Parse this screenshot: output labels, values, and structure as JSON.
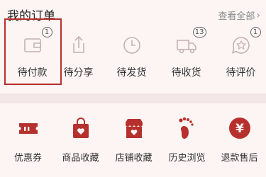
{
  "header": {
    "title": "我的订单",
    "view_all": "查看全部"
  },
  "order_status": [
    {
      "label": "待付款",
      "badge": "1",
      "icon": "wallet-icon"
    },
    {
      "label": "待分享",
      "badge": "",
      "icon": "share-icon"
    },
    {
      "label": "待发货",
      "badge": "",
      "icon": "clock-icon"
    },
    {
      "label": "待收货",
      "badge": "13",
      "icon": "truck-icon"
    },
    {
      "label": "待评价",
      "badge": "1",
      "icon": "review-icon"
    }
  ],
  "tools": [
    {
      "label": "优惠券",
      "icon": "coupon-icon"
    },
    {
      "label": "商品收藏",
      "icon": "shopping-bag-heart-icon"
    },
    {
      "label": "店铺收藏",
      "icon": "store-heart-icon"
    },
    {
      "label": "历史浏览",
      "icon": "footprint-icon"
    },
    {
      "label": "退款售后",
      "icon": "refund-icon"
    }
  ],
  "colors": {
    "accent": "#b6312d",
    "icon_outline": "#b9a6a6",
    "background": "#fdf4f4"
  }
}
